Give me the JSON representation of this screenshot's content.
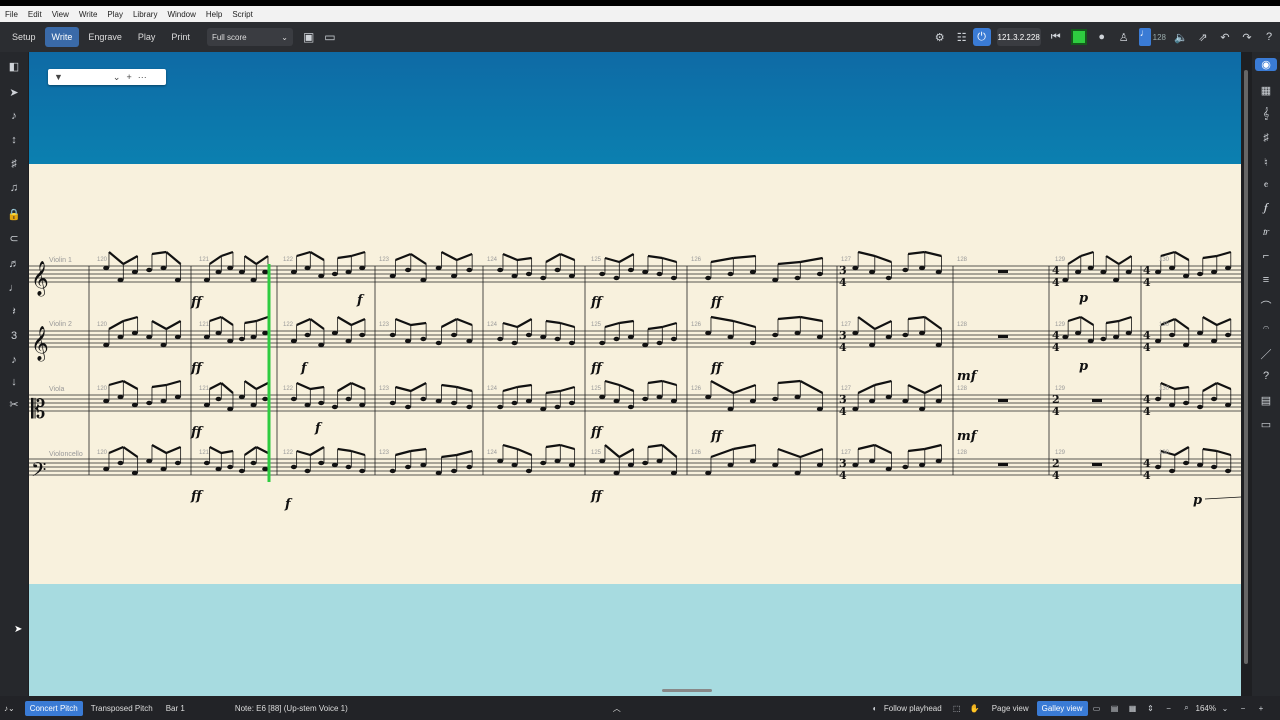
{
  "menu": [
    "File",
    "Edit",
    "View",
    "Write",
    "Play",
    "Library",
    "Window",
    "Help",
    "Script"
  ],
  "modes": [
    {
      "label": "Setup",
      "active": false
    },
    {
      "label": "Write",
      "active": true
    },
    {
      "label": "Engrave",
      "active": false
    },
    {
      "label": "Play",
      "active": false
    },
    {
      "label": "Print",
      "active": false
    }
  ],
  "layout_selector": "Full score",
  "transport": {
    "timecode": "121.3.2.228",
    "tempo": "128"
  },
  "instruments": [
    "Violin 1",
    "Violin 2",
    "Viola",
    "Violoncello"
  ],
  "bars": [
    "120",
    "121",
    "122",
    "123",
    "124",
    "125",
    "126",
    "127",
    "128",
    "129",
    "130"
  ],
  "dynamics": {
    "ff": "ff",
    "f": "f",
    "mf": "mf",
    "p": "p"
  },
  "time_signature": {
    "top": "3",
    "bottom": "4",
    "top2": "2",
    "top3": "4"
  },
  "filter": {
    "icon": "filter-icon"
  },
  "status": {
    "concert_pitch": "Concert Pitch",
    "transposed_pitch": "Transposed Pitch",
    "bar": "Bar 1",
    "note": "Note: E6 [88] (Up-stem Voice 1)",
    "follow_playhead": "Follow playhead",
    "page_view": "Page view",
    "galley_view": "Galley view",
    "zoom": "164%"
  },
  "colors": {
    "accent": "#3a7bd5",
    "playhead": "#2ecc40",
    "paper": "#f8f1dd"
  }
}
